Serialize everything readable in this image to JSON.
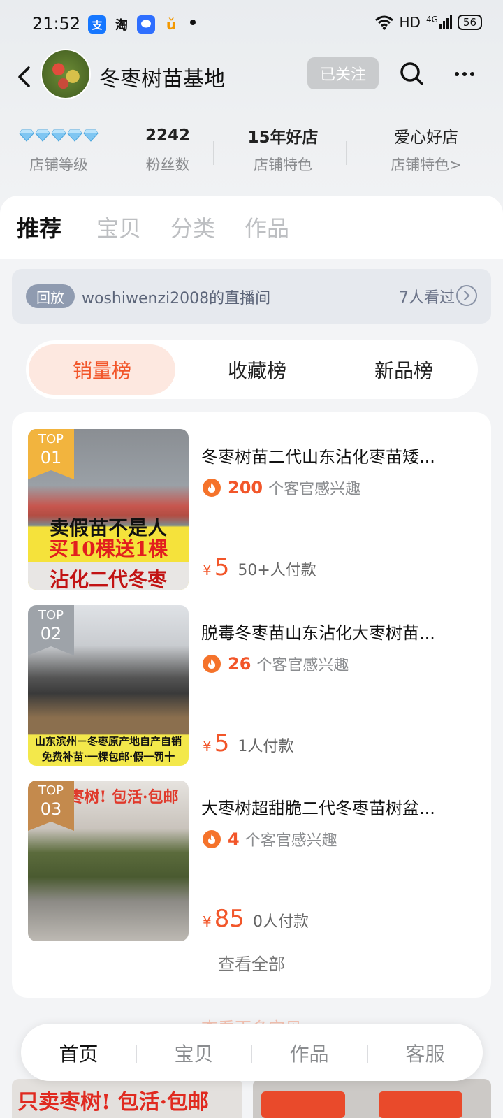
{
  "status_bar": {
    "time": "21:52",
    "app_icons": [
      {
        "name": "alipay-icon",
        "glyph": "支"
      },
      {
        "name": "taobao-icon",
        "glyph": "淘"
      },
      {
        "name": "chat-icon",
        "glyph": "●"
      },
      {
        "name": "app-icon",
        "glyph": "ǔ"
      }
    ],
    "network": "HD",
    "signal": "4G",
    "battery": "56"
  },
  "shop": {
    "name": "冬枣树苗基地",
    "follow_label": "已关注"
  },
  "stats": [
    {
      "value": "",
      "label": "店铺等级",
      "diamonds": 5
    },
    {
      "value": "2242",
      "label": "粉丝数"
    },
    {
      "value": "15年好店",
      "label": "店铺特色"
    },
    {
      "value": "爱心好店",
      "label": "店铺特色>"
    }
  ],
  "tabs": [
    "推荐",
    "宝贝",
    "分类",
    "作品"
  ],
  "live": {
    "badge": "回放",
    "title": "woshiwenzi2008的直播间",
    "viewers": "7人看过"
  },
  "rank_tabs": [
    "销量榜",
    "收藏榜",
    "新品榜"
  ],
  "items": [
    {
      "badge_top": "TOP",
      "badge_num": "01",
      "title": "冬枣树苗二代山东沾化枣苗矮...",
      "interest_count": "200",
      "interest_text": "个客官感兴趣",
      "currency": "¥",
      "price": "5",
      "payers": "50+人付款",
      "image_text": [
        "卖假苗不是人",
        "买10棵送1棵",
        "沾化二代冬枣"
      ]
    },
    {
      "badge_top": "TOP",
      "badge_num": "02",
      "title": "脱毒冬枣苗山东沾化大枣树苗...",
      "interest_count": "26",
      "interest_text": "个客官感兴趣",
      "currency": "¥",
      "price": "5",
      "payers": "1人付款",
      "image_text": [
        "山东滨州－冬枣原产地自产自销",
        "免费补苗·一棵包邮·假一罚十"
      ]
    },
    {
      "badge_top": "TOP",
      "badge_num": "03",
      "title": "大枣树超甜脆二代冬枣苗树盆...",
      "interest_count": "4",
      "interest_text": "个客官感兴趣",
      "currency": "¥",
      "price": "85",
      "payers": "0人付款",
      "image_text": [
        "只卖枣树! 包活·包邮"
      ]
    }
  ],
  "view_all": "查看全部",
  "peek": {
    "hint": "查看更多宝贝",
    "left_text": "只卖枣树! 包活·包邮"
  },
  "bottom_nav": [
    "首页",
    "宝贝",
    "作品",
    "客服"
  ],
  "colors": {
    "accent": "#f2562a",
    "follow_bg": "#c9cbcd",
    "live_bg": "#e6e9ee",
    "rank_active_bg": "#fde8e0"
  }
}
